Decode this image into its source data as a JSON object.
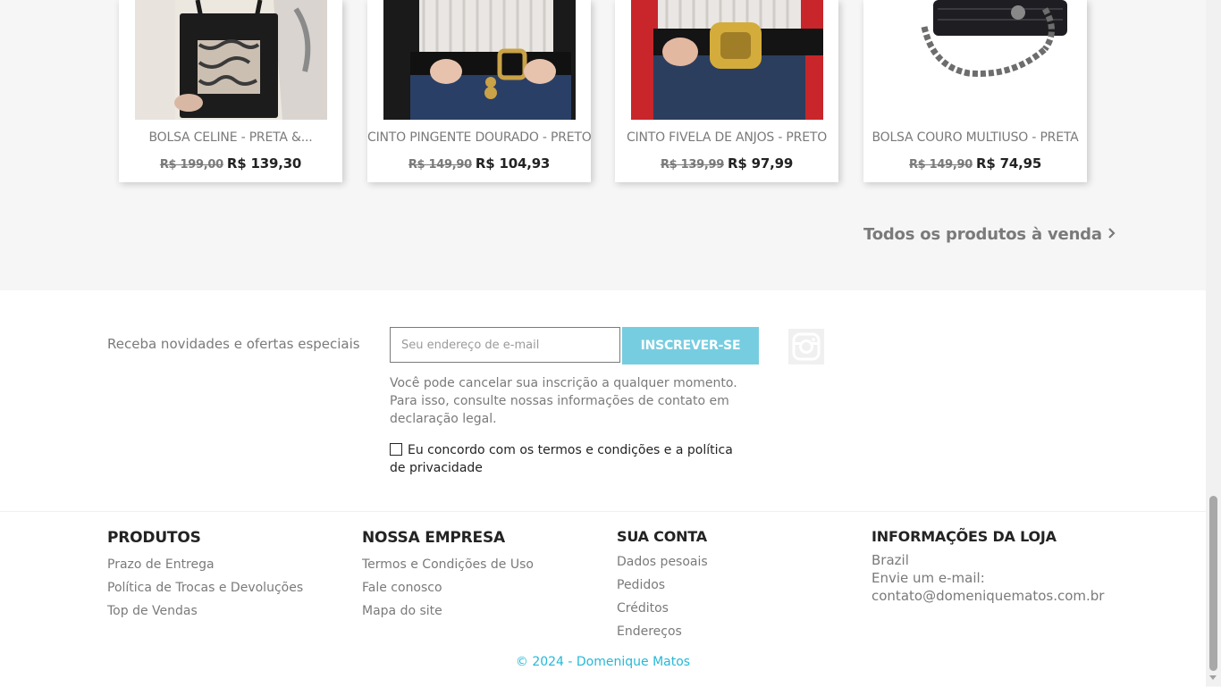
{
  "products": [
    {
      "name": "BOLSA CELINE - PRETA &...",
      "old_price": "R$ 199,00",
      "price": "R$ 139,30"
    },
    {
      "name": "CINTO PINGENTE DOURADO - PRETO",
      "old_price": "R$ 149,90",
      "price": "R$ 104,93"
    },
    {
      "name": "CINTO FIVELA DE ANJOS - PRETO",
      "old_price": "R$ 139,99",
      "price": "R$ 97,99"
    },
    {
      "name": "BOLSA COURO MULTIUSO - PRETA",
      "old_price": "R$ 149,90",
      "price": "R$ 74,95"
    }
  ],
  "all_products_link": "Todos os produtos à venda",
  "newsletter": {
    "label": "Receba novidades e ofertas especiais",
    "placeholder": "Seu endereço de e-mail",
    "button": "INSCREVER-SE",
    "help": "Você pode cancelar sua inscrição a qualquer momento. Para isso, consulte nossas informações de contato em declaração legal.",
    "consent": "Eu concordo com os termos e condições e a política de privacidade"
  },
  "footer": {
    "produtos": {
      "title": "PRODUTOS",
      "links": [
        "Prazo de Entrega",
        "Política de Trocas e Devoluções",
        "Top de Vendas"
      ]
    },
    "empresa": {
      "title": "NOSSA EMPRESA",
      "links": [
        "Termos e Condições de Uso",
        "Fale conosco",
        "Mapa do site"
      ]
    },
    "conta": {
      "title": "SUA CONTA",
      "links": [
        "Dados pesoais",
        "Pedidos",
        "Créditos",
        "Endereços"
      ]
    },
    "loja": {
      "title": "INFORMAÇÕES DA LOJA",
      "country": "Brazil",
      "email_label": "Envie um e-mail:",
      "email": "contato@domeniquematos.com.br"
    },
    "copyright": "© 2024 - Domenique Matos"
  },
  "colors": {
    "accent": "#77cde0",
    "link": "#24b9d7",
    "text": "#7a7a7a",
    "heading": "#232323"
  }
}
